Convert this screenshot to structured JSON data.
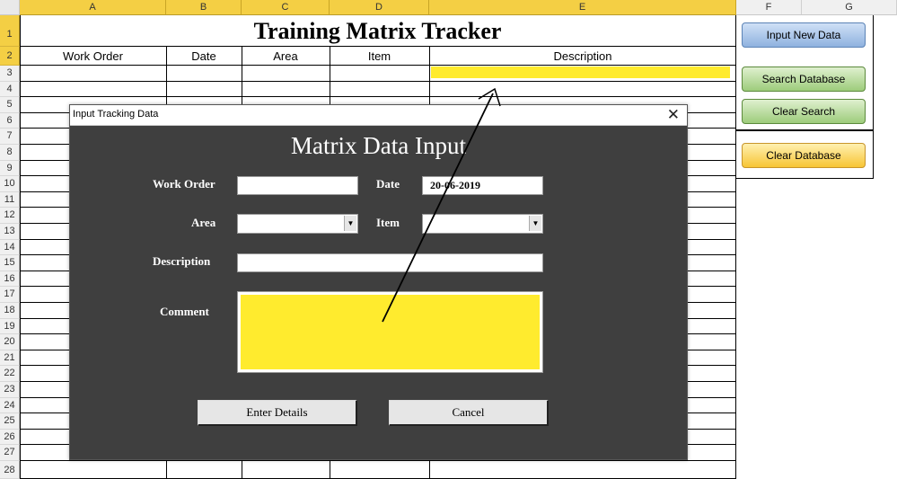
{
  "columns": [
    "A",
    "B",
    "C",
    "D",
    "E",
    "F",
    "G"
  ],
  "rows": [
    "1",
    "2",
    "3",
    "4",
    "5",
    "6",
    "7",
    "8",
    "9",
    "10",
    "11",
    "12",
    "13",
    "14",
    "15",
    "16",
    "17",
    "18",
    "19",
    "20",
    "21",
    "22",
    "23",
    "24",
    "25",
    "26",
    "27",
    "28"
  ],
  "sheet": {
    "title": "Training Matrix Tracker",
    "headers": [
      "Work Order",
      "Date",
      "Area",
      "Item",
      "Description"
    ]
  },
  "side_buttons": {
    "input_new": "Input New Data",
    "search": "Search Database",
    "clear_search": "Clear Search",
    "clear_db": "Clear Database"
  },
  "dialog": {
    "window_title": "Input Tracking Data",
    "close_glyph": "✕",
    "heading": "Matrix Data Input",
    "labels": {
      "work_order": "Work Order",
      "date": "Date",
      "area": "Area",
      "item": "Item",
      "description": "Description",
      "comment": "Comment"
    },
    "values": {
      "work_order": "",
      "date": "20-06-2019",
      "area": "",
      "item": "",
      "description": ""
    },
    "buttons": {
      "enter": "Enter Details",
      "cancel": "Cancel"
    }
  },
  "colors": {
    "header_selected": "#f4cf44",
    "highlight_yellow": "#ffeb2e",
    "dialog_bg": "#3f3f3f"
  }
}
